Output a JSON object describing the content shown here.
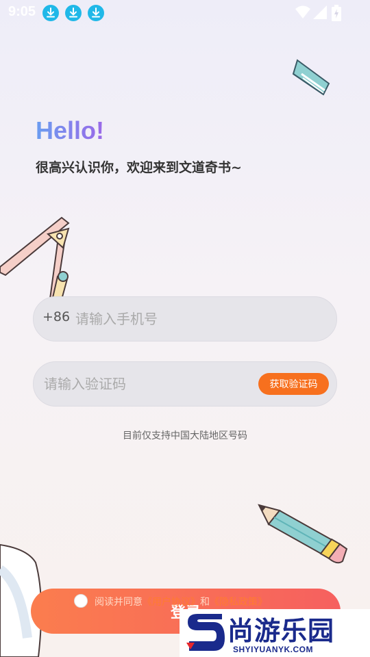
{
  "status_bar": {
    "time": "9:05",
    "notification_icons": [
      "download-icon",
      "download-icon",
      "download-icon"
    ],
    "system_icons": [
      "wifi-icon",
      "signal-icon",
      "battery-icon"
    ]
  },
  "header": {
    "greeting": "Hello!",
    "welcome": "很高兴认识你，欢迎来到文道奇书~"
  },
  "phone": {
    "prefix": "+86",
    "placeholder": "请输入手机号"
  },
  "code": {
    "placeholder": "请输入验证码",
    "get_code_label": "获取验证码"
  },
  "hint": "目前仅支持中国大陆地区号码",
  "login": {
    "label": "登录"
  },
  "agreement": {
    "prefix": "阅读并同意",
    "user_agreement": "《用户协议》",
    "and": "和",
    "privacy_policy": "《隐私政策》"
  },
  "watermark": {
    "logo": "S",
    "title": "尚游乐园",
    "subtitle": "SHYIYUANYK.COM"
  },
  "colors": {
    "accent_orange": "#f7701e",
    "login_gradient": [
      "#fb7d4e",
      "#f6605f"
    ],
    "hello_gradient": [
      "#6a9df0",
      "#9b68e8"
    ],
    "status_icon_blue": "#20b8e8"
  }
}
